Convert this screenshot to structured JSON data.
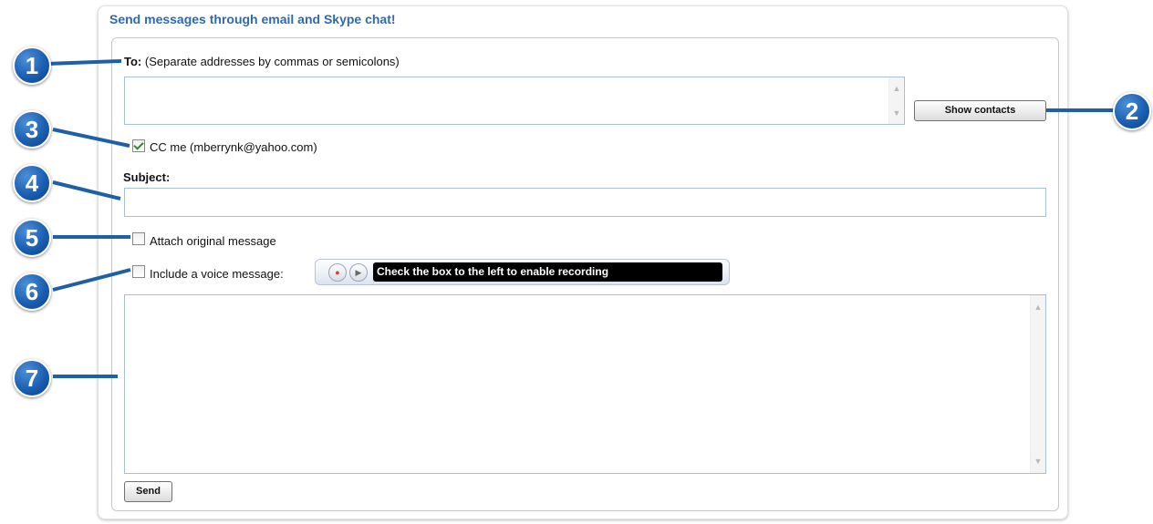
{
  "form": {
    "heading": "Send messages through email and Skype chat!",
    "to_label_bold": "To:",
    "to_label_hint": "(Separate addresses by commas or semicolons)",
    "to_value": "",
    "show_contacts_label": "Show contacts",
    "cc_me_label": "CC me (mberrynk@yahoo.com)",
    "cc_me_checked": true,
    "subject_label": "Subject:",
    "subject_value": "",
    "attach_label": "Attach original message",
    "attach_checked": false,
    "voice_label": "Include a voice message:",
    "voice_checked": false,
    "recorder_status": "Check the box to the left to enable recording",
    "message_value": "",
    "send_label": "Send"
  },
  "callouts": [
    "1",
    "2",
    "3",
    "4",
    "5",
    "6",
    "7"
  ],
  "colors": {
    "heading": "#2c6ab4",
    "callout": "#1a5fb4",
    "recorder_status_bg": "#000000"
  },
  "icons": {
    "record": "record-icon",
    "play": "play-icon",
    "scroll_up": "scroll-up-icon",
    "scroll_down": "scroll-down-icon"
  }
}
